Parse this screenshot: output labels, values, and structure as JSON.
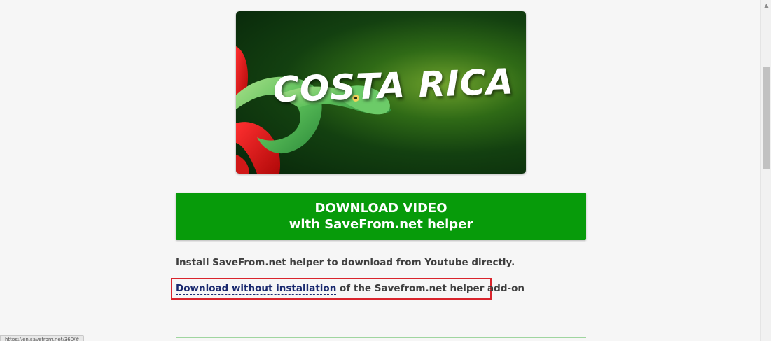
{
  "video": {
    "thumbnail_title": "COSTA RICA"
  },
  "download_button": {
    "line1": "DOWNLOAD VIDEO",
    "line2": "with SaveFrom.net helper"
  },
  "install_note": "Install SaveFrom.net helper to download from Youtube directly.",
  "alt_download": {
    "link_text": "Download without installation",
    "suffix": " of the Savefrom.net helper add-on"
  },
  "status_bar": {
    "url": "https://en.savefrom.net/360/#"
  },
  "colors": {
    "button_green": "#079b0a",
    "link_blue": "#1b2a6f",
    "highlight_red": "#d9242c"
  }
}
